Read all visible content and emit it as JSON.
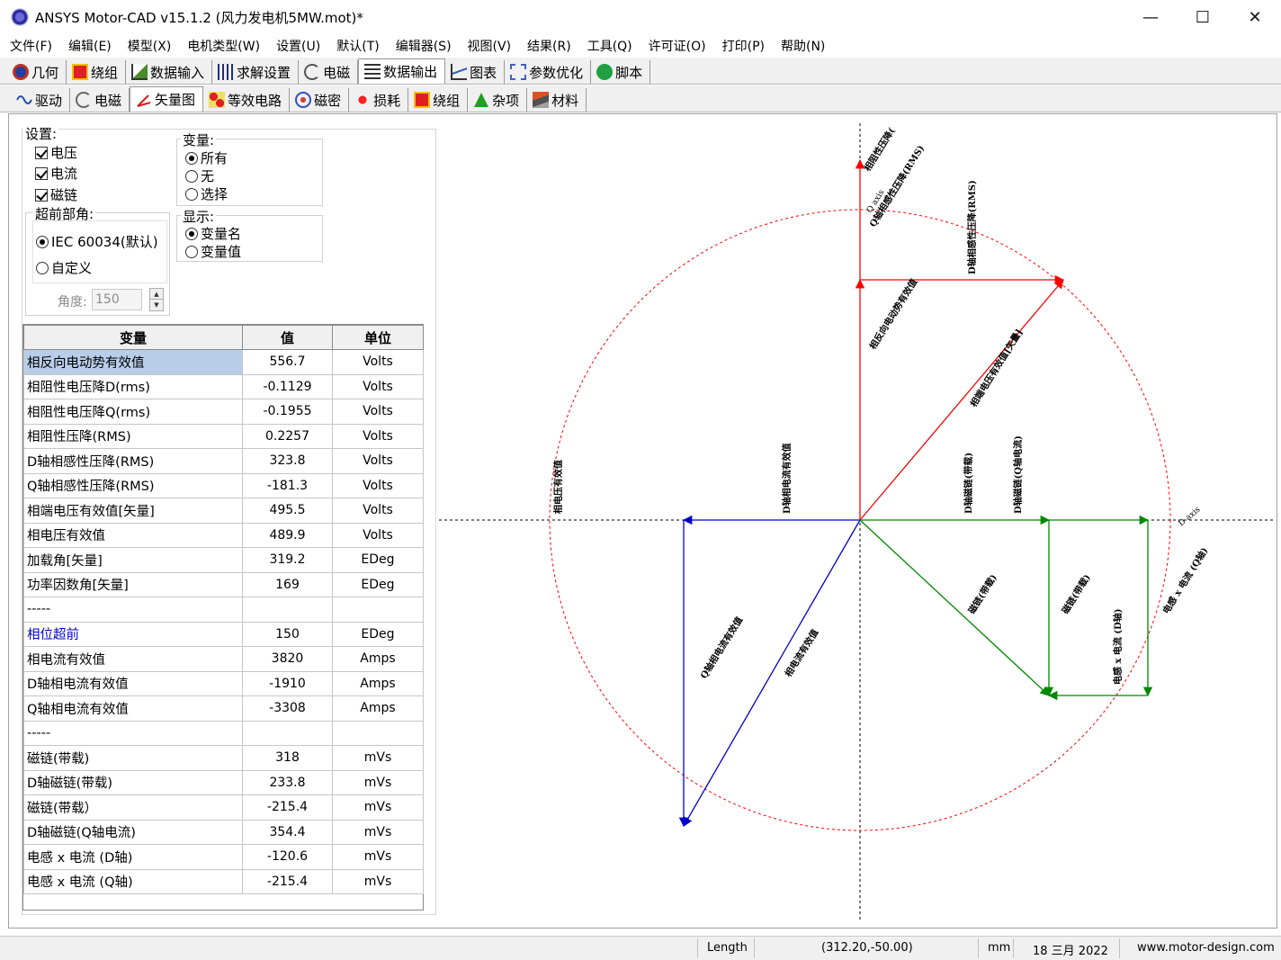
{
  "window": {
    "title": "ANSYS Motor-CAD v15.1.2 (风力发电机5MW.mot)*",
    "minimize": "—",
    "maximize": "☐",
    "close": "✕"
  },
  "menu": [
    "文件(F)",
    "编辑(E)",
    "模型(X)",
    "电机类型(W)",
    "设置(U)",
    "默认(T)",
    "编辑器(S)",
    "视图(V)",
    "结果(R)",
    "工具(Q)",
    "许可证(O)",
    "打印(P)",
    "帮助(N)"
  ],
  "main_tabs": [
    {
      "label": "几何",
      "icon": "geometry-icon"
    },
    {
      "label": "绕组",
      "icon": "winding-icon"
    },
    {
      "label": "数据输入",
      "icon": "input-data-icon"
    },
    {
      "label": "求解设置",
      "icon": "solver-settings-icon"
    },
    {
      "label": "电磁",
      "icon": "electromagnetic-icon"
    },
    {
      "label": "数据输出",
      "icon": "output-data-icon"
    },
    {
      "label": "图表",
      "icon": "chart-icon"
    },
    {
      "label": "参数优化",
      "icon": "optimisation-icon"
    },
    {
      "label": "脚本",
      "icon": "script-icon"
    }
  ],
  "sub_tabs": [
    {
      "label": "驱动",
      "icon": "drive-wave-icon"
    },
    {
      "label": "电磁",
      "icon": "emag-icon"
    },
    {
      "label": "矢量图",
      "icon": "vector-icon"
    },
    {
      "label": "等效电路",
      "icon": "circuit-icon"
    },
    {
      "label": "磁密",
      "icon": "flux-density-icon"
    },
    {
      "label": "损耗",
      "icon": "losses-icon"
    },
    {
      "label": "绕组",
      "icon": "winding-icon"
    },
    {
      "label": "杂项",
      "icon": "misc-icon"
    },
    {
      "label": "材料",
      "icon": "materials-icon"
    }
  ],
  "settings": {
    "label": "设置:",
    "voltage": "电压",
    "current": "电流",
    "flux": "磁链"
  },
  "variables_group": {
    "label": "变量:",
    "all": "所有",
    "none": "无",
    "select": "选择"
  },
  "display_group": {
    "label": "显示:",
    "names": "变量名",
    "values": "变量值"
  },
  "advance_group": {
    "label": "超前部角:",
    "iec": "IEC 60034(默认)",
    "custom": "自定义",
    "angle_label": "角度:",
    "angle_value": "150"
  },
  "table": {
    "headers": [
      "变量",
      "值",
      "单位"
    ],
    "rows": [
      [
        "相反向电动势有效值",
        "556.7",
        "Volts"
      ],
      [
        "相阻性电压降D(rms)",
        "-0.1129",
        "Volts"
      ],
      [
        "相阻性电压降Q(rms)",
        "-0.1955",
        "Volts"
      ],
      [
        "相阻性压降(RMS)",
        "0.2257",
        "Volts"
      ],
      [
        "D轴相感性压降(RMS)",
        "323.8",
        "Volts"
      ],
      [
        "Q轴相感性压降(RMS)",
        "-181.3",
        "Volts"
      ],
      [
        "相端电压有效值[矢量]",
        "495.5",
        "Volts"
      ],
      [
        "相电压有效值",
        "489.9",
        "Volts"
      ],
      [
        "加载角[矢量]",
        "319.2",
        "EDeg"
      ],
      [
        "功率因数角[矢量]",
        "169",
        "EDeg"
      ],
      [
        "-----",
        "",
        ""
      ],
      [
        "相位超前",
        "150",
        "EDeg"
      ],
      [
        "相电流有效值",
        "3820",
        "Amps"
      ],
      [
        "D轴相电流有效值",
        "-1910",
        "Amps"
      ],
      [
        "Q轴相电流有效值",
        "-3308",
        "Amps"
      ],
      [
        "-----",
        "",
        ""
      ],
      [
        "磁链(带载)",
        "318",
        "mVs"
      ],
      [
        "D轴磁链(带载)",
        "233.8",
        "mVs"
      ],
      [
        "磁链(带载）",
        "-215.4",
        "mVs"
      ],
      [
        "D轴磁链(Q轴电流)",
        "354.4",
        "mVs"
      ],
      [
        " 电感 x 电流 (D轴)",
        "-120.6",
        "mVs"
      ],
      [
        "电感 x 电流 (Q轴)",
        "-215.4",
        "mVs"
      ]
    ]
  },
  "diagram": {
    "q_axis": "Q axis",
    "d_axis": "D axis",
    "labels": {
      "resistive_drop": "相阻性压降(",
      "q_inductive": "Q轴相感性压降(RMS)",
      "d_inductive": "D轴相感性压降(RMS)",
      "back_emf": "相反向电动势有效值",
      "terminal_voltage": "相端电压有效值[矢量]",
      "d_current": "D轴相电流有效值",
      "phase_voltage": "相电压有效值",
      "d_flux": "D轴磁链(带载)",
      "d_flux_q": "D轴磁链(Q轴电流)",
      "flux_load": "磁链(带载)",
      "flux_load2": "磁链(带载)",
      "lxi_d": "电感 x 电流 (D轴)",
      "lxi_q": "电感 x 电流 (Q轴)",
      "q_current": "Q轴相电流有效值",
      "phase_current": "相电流有效值"
    },
    "colors": {
      "voltage": "#ff0000",
      "current": "#0000cc",
      "flux": "#008800",
      "circle": "#ff0000"
    }
  },
  "status": {
    "field": "Length",
    "coords": "(312.20,-50.00)",
    "unit": "mm",
    "date": "18 三月 2022",
    "site": "www.motor-design.com"
  }
}
